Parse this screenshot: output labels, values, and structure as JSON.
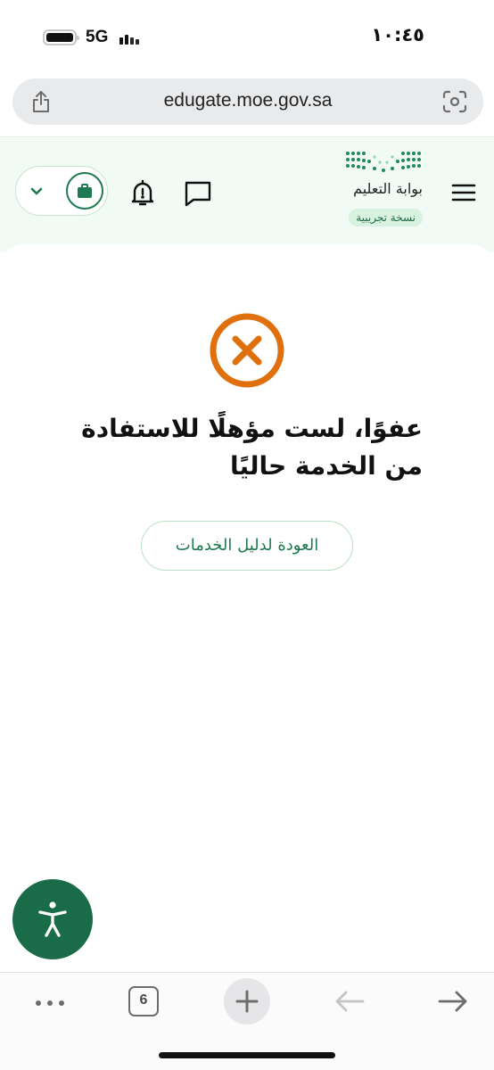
{
  "status_bar": {
    "network": "5G",
    "time": "١٠:٤٥",
    "battery_level": 1.0
  },
  "browser": {
    "url": "edugate.moe.gov.sa"
  },
  "header": {
    "logo_title": "بوابة التعليم",
    "trial_badge": "نسخة تجريبية",
    "icons": [
      "menu-icon",
      "chat-icon",
      "bell-icon",
      "chevron-down-icon",
      "briefcase-icon"
    ]
  },
  "error": {
    "icon": "error-x-circle-icon",
    "message": "عفوًا، لست مؤهلًا للاستفادة من الخدمة حاليًا",
    "back_button": "العودة لدليل الخدمات"
  },
  "accessibility": {
    "icon": "accessibility-icon"
  },
  "toolbar": {
    "tab_count": "6",
    "icons": [
      "more-icon",
      "tabs-icon",
      "plus-icon",
      "back-arrow-icon",
      "forward-arrow-icon"
    ]
  },
  "colors": {
    "brand_green": "#1e7a50",
    "error_orange": "#e0700e",
    "header_bg": "#f1faf4"
  }
}
